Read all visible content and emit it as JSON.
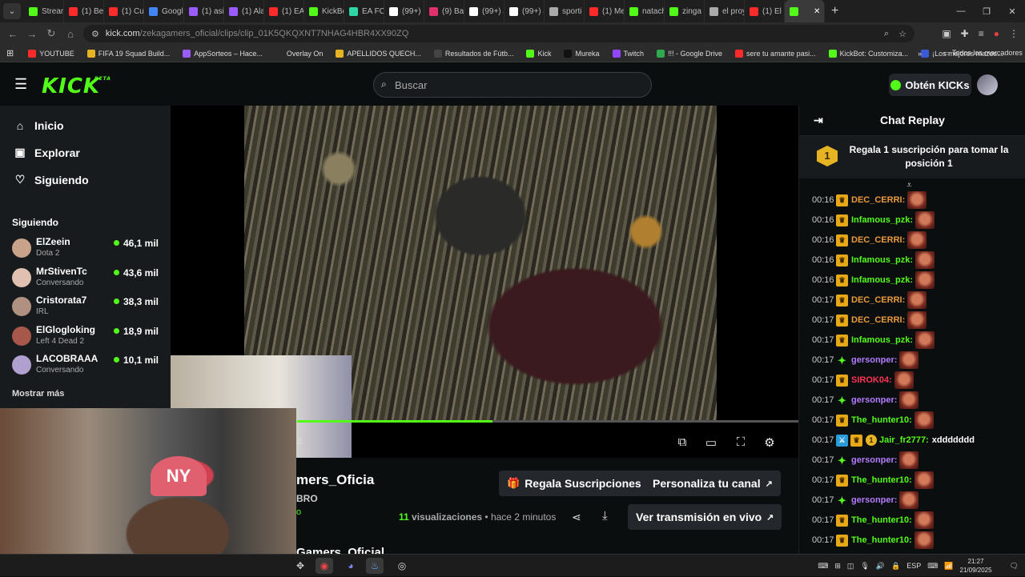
{
  "browser": {
    "tabs": [
      {
        "label": "Stream",
        "color": "#53fc18"
      },
      {
        "label": "(1) Be",
        "color": "#ff2a2a"
      },
      {
        "label": "(1) Cu",
        "color": "#ff2a2a"
      },
      {
        "label": "Googl",
        "color": "#4285f4"
      },
      {
        "label": "(1) asi",
        "color": "#9b5cff"
      },
      {
        "label": "(1) Ala",
        "color": "#9b5cff"
      },
      {
        "label": "(1) EA",
        "color": "#ff2a2a"
      },
      {
        "label": "KickBo",
        "color": "#53fc18"
      },
      {
        "label": "EA FC",
        "color": "#2fd6a5"
      },
      {
        "label": "(99+) R",
        "color": "#ffffff"
      },
      {
        "label": "(9) Bar",
        "color": "#e1306c"
      },
      {
        "label": "(99+) J",
        "color": "#ffffff"
      },
      {
        "label": "(99+) J",
        "color": "#ffffff"
      },
      {
        "label": "sporti",
        "color": "#aaaaaa"
      },
      {
        "label": "(1) Me",
        "color": "#ff2a2a"
      },
      {
        "label": "natach",
        "color": "#53fc18"
      },
      {
        "label": "zinga",
        "color": "#53fc18"
      },
      {
        "label": "el proy",
        "color": "#aaaaaa"
      },
      {
        "label": "(1) El P",
        "color": "#ff2a2a"
      },
      {
        "label": "",
        "color": "#53fc18",
        "active": true
      }
    ],
    "url_host": "kick.com",
    "url_path": "/zekagamers_oficial/clips/clip_01K5QKQXNT7NHAG4HBR4XX90ZQ",
    "bookmarks": [
      {
        "label": "YOUTUBE",
        "color": "#ff2a2a"
      },
      {
        "label": "FIFA 19 Squad Build...",
        "color": "#e6b422"
      },
      {
        "label": "AppSorteos – Hace...",
        "color": "#9b5cff"
      },
      {
        "label": "Overlay On",
        "color": "#2b2b2b"
      },
      {
        "label": "APELLIDOS QUECH...",
        "color": "#e6b422"
      },
      {
        "label": "Resultados de Fútb...",
        "color": "#444444"
      },
      {
        "label": "Kick",
        "color": "#53fc18"
      },
      {
        "label": "Mureka",
        "color": "#111111"
      },
      {
        "label": "Twitch",
        "color": "#9146ff"
      },
      {
        "label": "!!! - Google Drive",
        "color": "#2fa84f"
      },
      {
        "label": "sere tu amante pasi...",
        "color": "#ff2a2a"
      },
      {
        "label": "KickBot: Customiza...",
        "color": "#53fc18"
      },
      {
        "label": "¡Los mejores mazos...",
        "color": "#3a5cd8"
      }
    ],
    "all_bookmarks": "Todos los marcadores"
  },
  "header": {
    "logo": "KICK",
    "beta": "BETA",
    "search_placeholder": "Buscar",
    "get_kicks": "Obtén KICKs"
  },
  "sidebar": {
    "nav": [
      {
        "label": "Inicio",
        "icon": "home-icon",
        "glyph": "⌂"
      },
      {
        "label": "Explorar",
        "icon": "explore-icon",
        "glyph": "▣"
      },
      {
        "label": "Siguiendo",
        "icon": "heart-icon",
        "glyph": "♡"
      }
    ],
    "following_title": "Siguiendo",
    "channels": [
      {
        "name": "ElZeein",
        "game": "Dota 2",
        "viewers": "46,1 mil",
        "color": "#c9a28a"
      },
      {
        "name": "MrStivenTc",
        "game": "Conversando",
        "viewers": "43,6 mil",
        "color": "#e0c0b0"
      },
      {
        "name": "Cristorata7",
        "game": "IRL",
        "viewers": "38,3 mil",
        "color": "#b09080"
      },
      {
        "name": "ElGlogloking",
        "game": "Left 4 Dead 2",
        "viewers": "18,9 mil",
        "color": "#a8584a"
      },
      {
        "name": "LACOBRAAA",
        "game": "Conversando",
        "viewers": "10,1 mil",
        "color": "#b0a0d0"
      }
    ],
    "show_more": "Mostrar más"
  },
  "player": {
    "progress": 0.39,
    "time_fragment": "8"
  },
  "clip": {
    "channel_partial": "mers_Oficia",
    "sub_partial": "BRO",
    "o_partial": "o",
    "bottom_partial": "Gamers_Oficial",
    "gift_button": "Regala Suscripciones",
    "customize_button": "Personaliza tu canal",
    "views_count": "11",
    "views_label": "visualizaciones",
    "time_ago": "hace 2 minutos",
    "watch_live": "Ver transmisión en vivo"
  },
  "chat": {
    "title": "Chat Replay",
    "pinned_rank": "1",
    "pinned_text": "Regala 1 suscripción para tomar la posición 1",
    "messages": [
      {
        "time": "00:16",
        "user": "DEC_CERRI",
        "color": "#e89a3c",
        "badge": "crown"
      },
      {
        "time": "00:16",
        "user": "Infamous_pzk",
        "color": "#53fc18",
        "badge": "crown"
      },
      {
        "time": "00:16",
        "user": "DEC_CERRI",
        "color": "#e89a3c",
        "badge": "crown"
      },
      {
        "time": "00:16",
        "user": "Infamous_pzk",
        "color": "#53fc18",
        "badge": "crown"
      },
      {
        "time": "00:16",
        "user": "Infamous_pzk",
        "color": "#53fc18",
        "badge": "crown"
      },
      {
        "time": "00:17",
        "user": "DEC_CERRI",
        "color": "#e89a3c",
        "badge": "crown"
      },
      {
        "time": "00:17",
        "user": "DEC_CERRI",
        "color": "#e89a3c",
        "badge": "crown"
      },
      {
        "time": "00:17",
        "user": "Infamous_pzk",
        "color": "#53fc18",
        "badge": "crown"
      },
      {
        "time": "00:17",
        "user": "gersonper",
        "color": "#b27cff",
        "badge": "sub"
      },
      {
        "time": "00:17",
        "user": "SIROK04",
        "color": "#ff3355",
        "badge": "crown"
      },
      {
        "time": "00:17",
        "user": "gersonper",
        "color": "#b27cff",
        "badge": "sub"
      },
      {
        "time": "00:17",
        "user": "The_hunter10",
        "color": "#53fc18",
        "badge": "crown"
      },
      {
        "time": "00:17",
        "user": "Jair_fr2777",
        "color": "#53fc18",
        "badge": "modgift",
        "text": "xddddddd"
      },
      {
        "time": "00:17",
        "user": "gersonper",
        "color": "#b27cff",
        "badge": "sub"
      },
      {
        "time": "00:17",
        "user": "The_hunter10",
        "color": "#53fc18",
        "badge": "crown"
      },
      {
        "time": "00:17",
        "user": "gersonper",
        "color": "#b27cff",
        "badge": "sub"
      },
      {
        "time": "00:17",
        "user": "The_hunter10",
        "color": "#53fc18",
        "badge": "crown"
      },
      {
        "time": "00:17",
        "user": "The_hunter10",
        "color": "#53fc18",
        "badge": "crown"
      }
    ]
  },
  "taskbar": {
    "lang": "ESP",
    "time": "21:27",
    "date": "21/09/2025"
  }
}
